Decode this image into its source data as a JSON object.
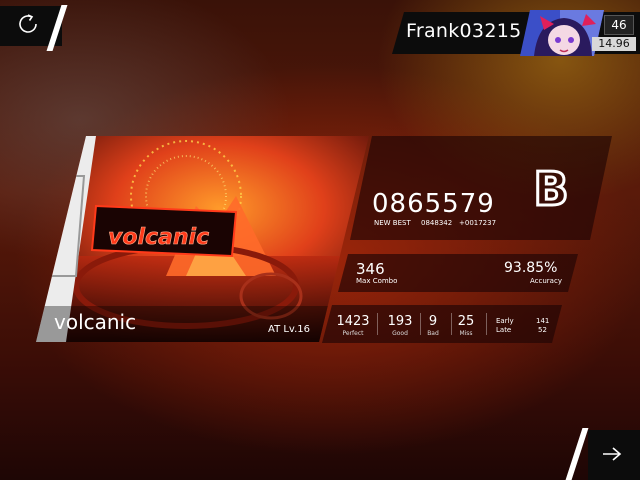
{
  "player": {
    "name": "Frank03215",
    "level": "46",
    "rks": "14.96"
  },
  "song": {
    "name": "volcanic",
    "difficulty": "AT Lv.16",
    "jacket_logo": "volcanic"
  },
  "score": {
    "value": "0865579",
    "new_best_label": "NEW BEST",
    "previous_best": "0848342",
    "difference": "+0017237",
    "grade": "B"
  },
  "combo": {
    "value": "346",
    "label": "Max Combo"
  },
  "accuracy": {
    "value": "93.85%",
    "label": "Accuracy"
  },
  "judgements": {
    "perfect": {
      "value": "1423",
      "label": "Perfect"
    },
    "good": {
      "value": "193",
      "label": "Good"
    },
    "bad": {
      "value": "9",
      "label": "Bad"
    },
    "miss": {
      "value": "25",
      "label": "Miss"
    },
    "early": {
      "label": "Early",
      "value": "141"
    },
    "late": {
      "label": "Late",
      "value": "52"
    }
  },
  "icons": {
    "retry": "retry-icon",
    "next": "arrow-right-icon"
  },
  "colors": {
    "accent": "#ff3a1a",
    "panel_dark": "#0c0c0c",
    "background": "#5a1a0a"
  }
}
